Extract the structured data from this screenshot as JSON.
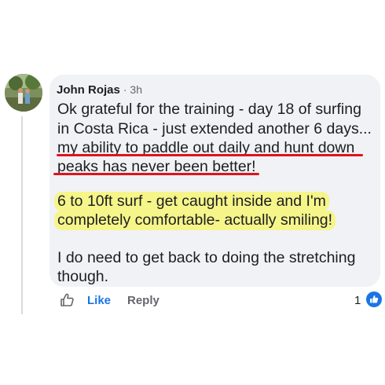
{
  "comment": {
    "author": "John Rojas",
    "time": "· 3h",
    "lines": [
      "Ok grateful for the training - day 18 of surfing",
      "in Costa Rica - just extended another 6 days...",
      "my ability to paddle out daily and hunt down",
      "peaks has never been better!",
      "6 to 10ft surf - get caught inside and I'm",
      "completely comfortable- actually smiling!",
      "I do need to get back to doing the stretching",
      "though."
    ]
  },
  "actions": {
    "like_label": "Like",
    "reply_label": "Reply",
    "reaction_count": "1"
  },
  "colors": {
    "like_blue": "#1b74e4",
    "underline_red": "#e1121e",
    "highlight_yellow": "#f6f58a",
    "bubble_gray": "#f0f2f5"
  },
  "icons": {
    "like": "like-outline-icon",
    "reaction": "thumbs-up-badge-icon"
  }
}
